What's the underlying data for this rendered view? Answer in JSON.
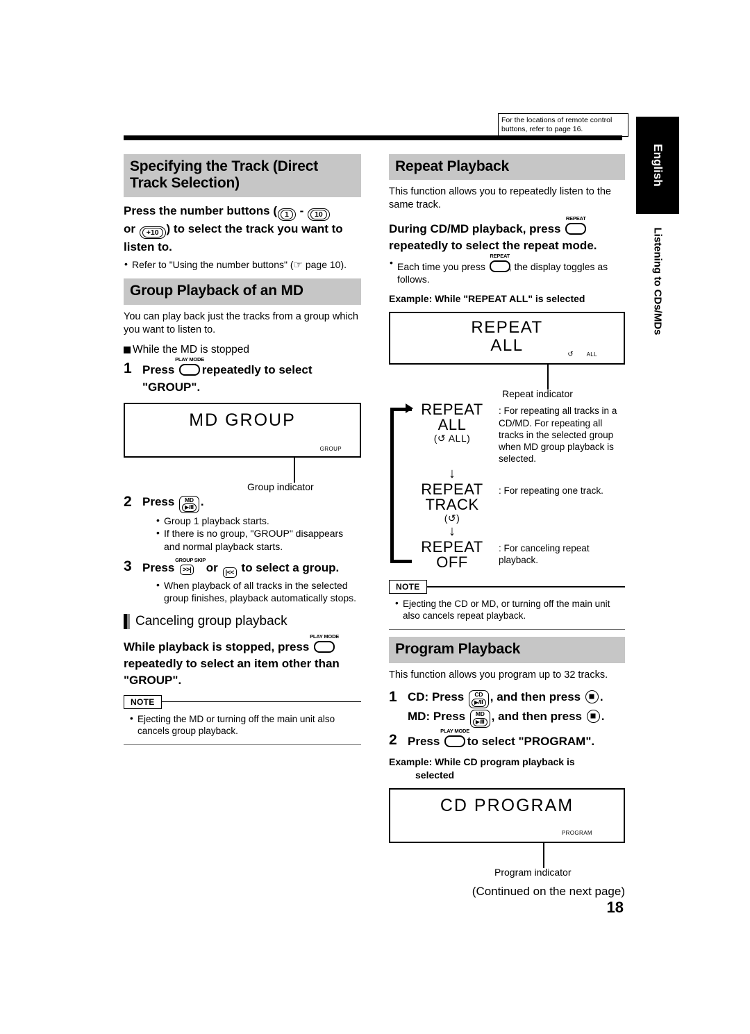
{
  "header": {
    "ref_note": "For the locations of remote control buttons, refer to page 16."
  },
  "side_tab": {
    "language": "English",
    "chapter": "Listening to CDs/MDs"
  },
  "left_column": {
    "section1": {
      "title": "Specifying the Track (Direct Track Selection)",
      "lead_a": "Press the number buttons (",
      "btn_1": "1",
      "lead_dash": "-",
      "btn_10": "10",
      "lead_b": "or",
      "btn_plus10": "+10",
      "lead_c": ") to select the track you want to listen to.",
      "bullet": "Refer to \"Using the number buttons\" (",
      "hand_icon": "☞",
      "bullet_tail": "page 10)."
    },
    "section2": {
      "title": "Group Playback of an MD",
      "intro": "You can play back just the tracks from a group which you want to listen to.",
      "sub_head": "While the MD is stopped",
      "step1": {
        "num": "1",
        "text_a": "Press",
        "button_label": "PLAY MODE",
        "text_b": "repeatedly to select \"GROUP\"."
      },
      "display1": {
        "text": "MD  GROUP",
        "indicator": "GROUP",
        "caption": "Group indicator"
      },
      "step2": {
        "num": "2",
        "text_a": "Press",
        "button_top": "MD",
        "button_sym": "▶/Ⅱ",
        "text_b": ".",
        "bullets": [
          "Group 1 playback starts.",
          "If there is no group, \"GROUP\" disappears and normal playback starts."
        ]
      },
      "step3": {
        "num": "3",
        "text_a": "Press",
        "button_label": "GROUP SKIP",
        "button_fwd": ">>|",
        "text_or": "or",
        "button_rev": "|<<",
        "text_b": "to select a group.",
        "bullets": [
          "When playback of all tracks in the selected group finishes, playback automatically stops."
        ]
      },
      "subsection": {
        "title": "Canceling group playback",
        "lead_a": "While playback is stopped, press",
        "button_label": "PLAY MODE",
        "lead_b": "repeatedly to select an item other than \"GROUP\"."
      },
      "note": {
        "label": "NOTE",
        "items": [
          "Ejecting the MD or turning off the main unit also cancels group playback."
        ]
      }
    }
  },
  "right_column": {
    "section1": {
      "title": "Repeat Playback",
      "intro": "This function allows you to repeatedly listen to the same track.",
      "lead_a": "During CD/MD playback, press",
      "button_label": "REPEAT",
      "lead_b": "repeatedly to select the repeat mode.",
      "bullet_a": "Each time you press",
      "bullet_b": ", the display toggles as follows.",
      "example_caption": "Example: While \"REPEAT ALL\" is selected",
      "display": {
        "line1": "REPEAT",
        "line2": "ALL",
        "indicator_loop": "↺",
        "indicator_all": "ALL",
        "caption": "Repeat indicator"
      },
      "cycle": [
        {
          "label1": "REPEAT",
          "label2": "ALL",
          "paren": "(↺  ALL)",
          "desc": ": For repeating all tracks in a CD/MD. For repeating all tracks in the selected group when MD group playback is selected."
        },
        {
          "label1": "REPEAT",
          "label2": "TRACK",
          "paren": "(↺)",
          "desc": ": For repeating one track."
        },
        {
          "label1": "REPEAT",
          "label2": "OFF",
          "paren": "",
          "desc": ": For canceling repeat playback."
        }
      ],
      "arrow_down": "↓",
      "note": {
        "label": "NOTE",
        "items": [
          "Ejecting the CD or MD, or turning off the main unit also cancels repeat playback."
        ]
      }
    },
    "section2": {
      "title": "Program Playback",
      "intro": "This function allows you program up to 32 tracks.",
      "step1": {
        "num": "1",
        "cd_a": "CD: Press",
        "cd_btn_top": "CD",
        "cd_btn_sym": "▶/Ⅱ",
        "cd_b": ", and then press",
        "cd_c": ".",
        "md_a": "MD: Press",
        "md_btn_top": "MD",
        "md_btn_sym": "▶/Ⅱ",
        "md_b": ", and then press",
        "md_c": "."
      },
      "step2": {
        "num": "2",
        "text_a": "Press",
        "button_label": "PLAY MODE",
        "text_b": "to select \"PROGRAM\"."
      },
      "example_caption_1": "Example: While CD program playback is",
      "example_caption_2": "selected",
      "display": {
        "text": "CD  PROGRAM",
        "indicator": "PROGRAM",
        "caption": "Program indicator"
      }
    },
    "continued": "(Continued on the next page)"
  },
  "page_number": "18"
}
